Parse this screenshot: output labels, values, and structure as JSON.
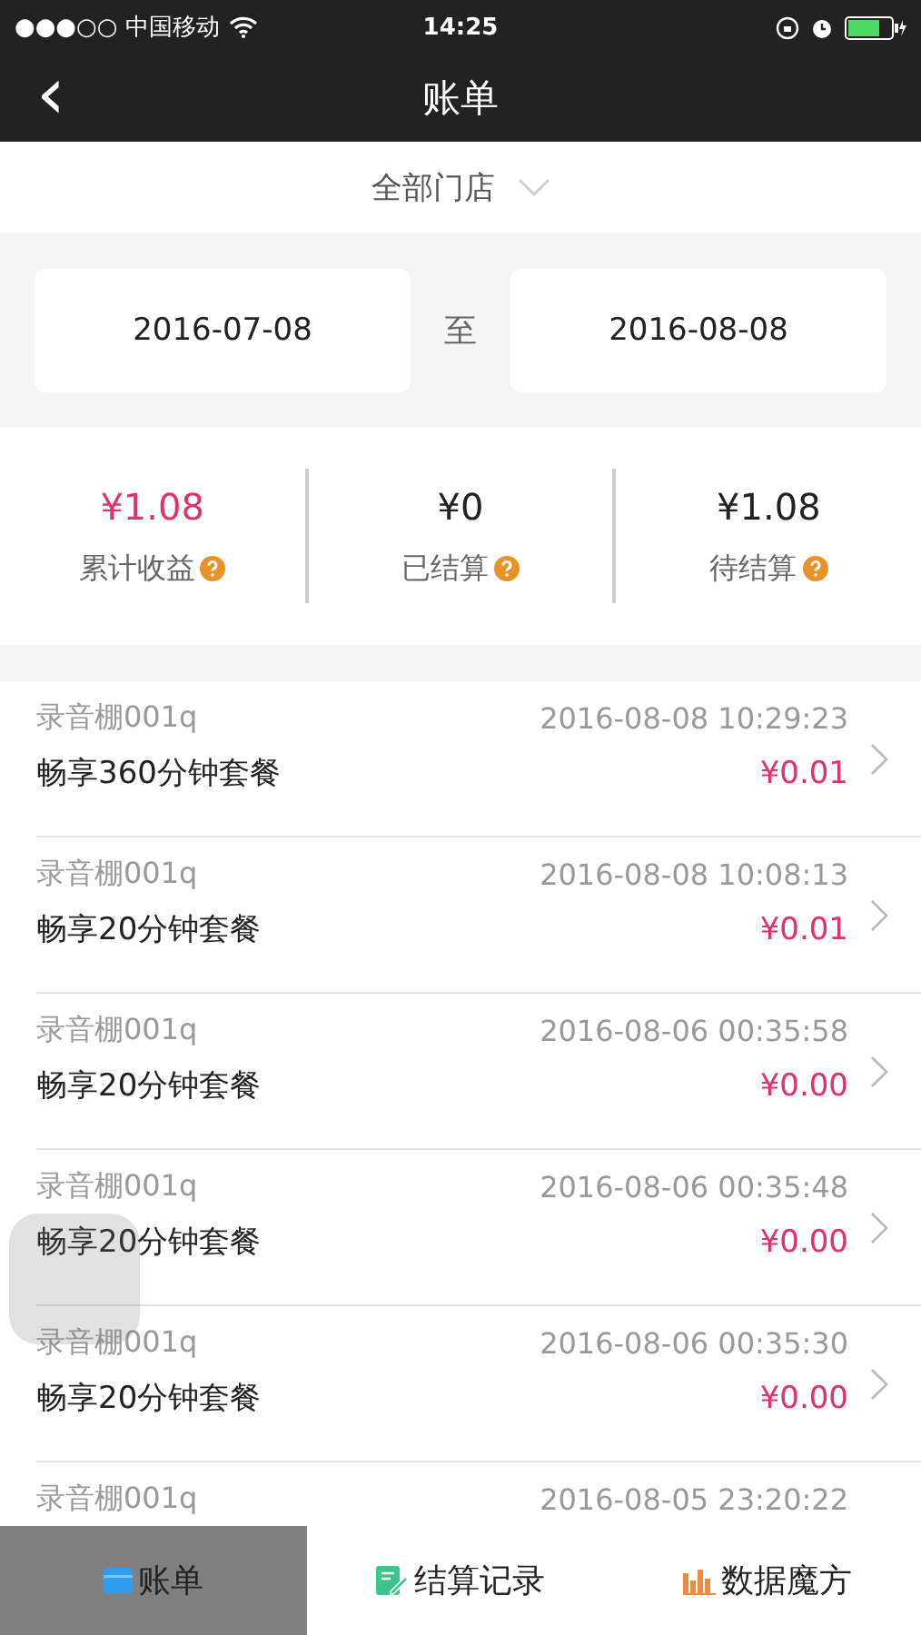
{
  "status_bar": {
    "carrier": "●●●○○ 中国移动",
    "time": "14:25"
  },
  "nav": {
    "back": "‹",
    "title": "账单"
  },
  "store_filter": {
    "label": "全部门店"
  },
  "date_range": {
    "start": "2016-07-08",
    "separator": "至",
    "end": "2016-08-08"
  },
  "summary": [
    {
      "amount": "¥1.08",
      "label": "累计收益",
      "highlight": true
    },
    {
      "amount": "¥0",
      "label": "已结算",
      "highlight": false
    },
    {
      "amount": "¥1.08",
      "label": "待结算",
      "highlight": false
    }
  ],
  "records": [
    {
      "store": "录音棚001q",
      "time": "2016-08-08 10:29:23",
      "package": "畅享360分钟套餐",
      "amount": "¥0.01"
    },
    {
      "store": "录音棚001q",
      "time": "2016-08-08 10:08:13",
      "package": "畅享20分钟套餐",
      "amount": "¥0.01"
    },
    {
      "store": "录音棚001q",
      "time": "2016-08-06 00:35:58",
      "package": "畅享20分钟套餐",
      "amount": "¥0.00"
    },
    {
      "store": "录音棚001q",
      "time": "2016-08-06 00:35:48",
      "package": "畅享20分钟套餐",
      "amount": "¥0.00"
    },
    {
      "store": "录音棚001q",
      "time": "2016-08-06 00:35:30",
      "package": "畅享20分钟套餐",
      "amount": "¥0.00"
    },
    {
      "store": "录音棚001q",
      "time": "2016-08-05 23:20:22"
    }
  ],
  "tabs": [
    {
      "label": "账单",
      "kind": "bill",
      "selected": true
    },
    {
      "label": "结算记录",
      "kind": "settle",
      "selected": false
    },
    {
      "label": "数据魔方",
      "kind": "data",
      "selected": false
    }
  ]
}
